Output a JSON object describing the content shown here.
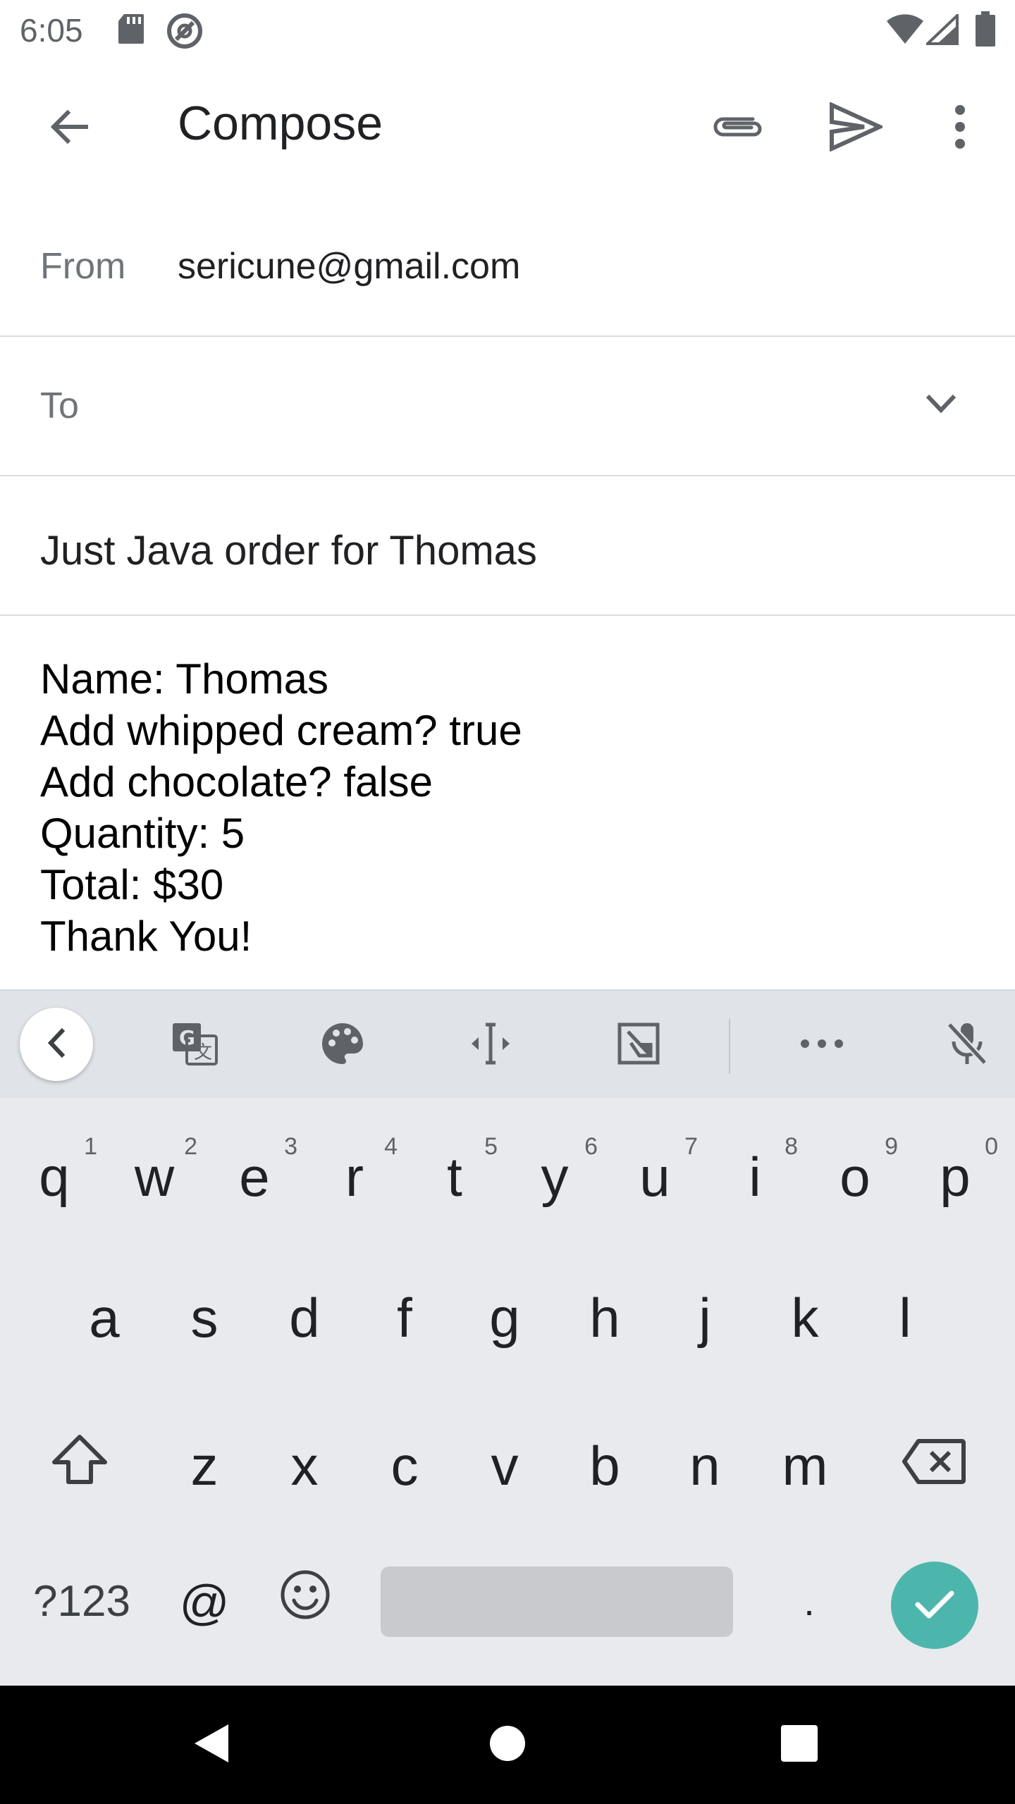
{
  "status_bar": {
    "time": "6:05",
    "icons": [
      "sd-card-icon",
      "at-sign-icon",
      "wifi-icon",
      "signal-icon",
      "battery-icon"
    ]
  },
  "app_bar": {
    "title": "Compose",
    "actions": [
      "back-arrow-icon",
      "attach-icon",
      "send-icon",
      "more-vert-icon"
    ]
  },
  "from": {
    "label": "From",
    "value": "sericune@gmail.com"
  },
  "to": {
    "label": "To",
    "value": ""
  },
  "subject": {
    "value": "Just Java order for Thomas"
  },
  "body": {
    "lines": [
      "Name: Thomas",
      "Add whipped cream? true",
      "Add chocolate? false",
      "Quantity: 5",
      "Total: $30",
      "Thank You!"
    ]
  },
  "keyboard": {
    "toolbar": [
      "chevron-left-icon",
      "translate-icon",
      "palette-icon",
      "text-cursor-icon",
      "floating-keyboard-icon",
      "more-horiz-icon",
      "mic-off-icon"
    ],
    "row1": [
      {
        "k": "q",
        "h": "1"
      },
      {
        "k": "w",
        "h": "2"
      },
      {
        "k": "e",
        "h": "3"
      },
      {
        "k": "r",
        "h": "4"
      },
      {
        "k": "t",
        "h": "5"
      },
      {
        "k": "y",
        "h": "6"
      },
      {
        "k": "u",
        "h": "7"
      },
      {
        "k": "i",
        "h": "8"
      },
      {
        "k": "o",
        "h": "9"
      },
      {
        "k": "p",
        "h": "0"
      }
    ],
    "row2": [
      "a",
      "s",
      "d",
      "f",
      "g",
      "h",
      "j",
      "k",
      "l"
    ],
    "row3": [
      "z",
      "x",
      "c",
      "v",
      "b",
      "n",
      "m"
    ],
    "symbols_label": "?123",
    "at_label": "@",
    "period_label": ".",
    "accent_color": "#4db6ac"
  },
  "nav_bar": {
    "buttons": [
      "nav-back-icon",
      "nav-home-icon",
      "nav-recents-icon"
    ]
  }
}
